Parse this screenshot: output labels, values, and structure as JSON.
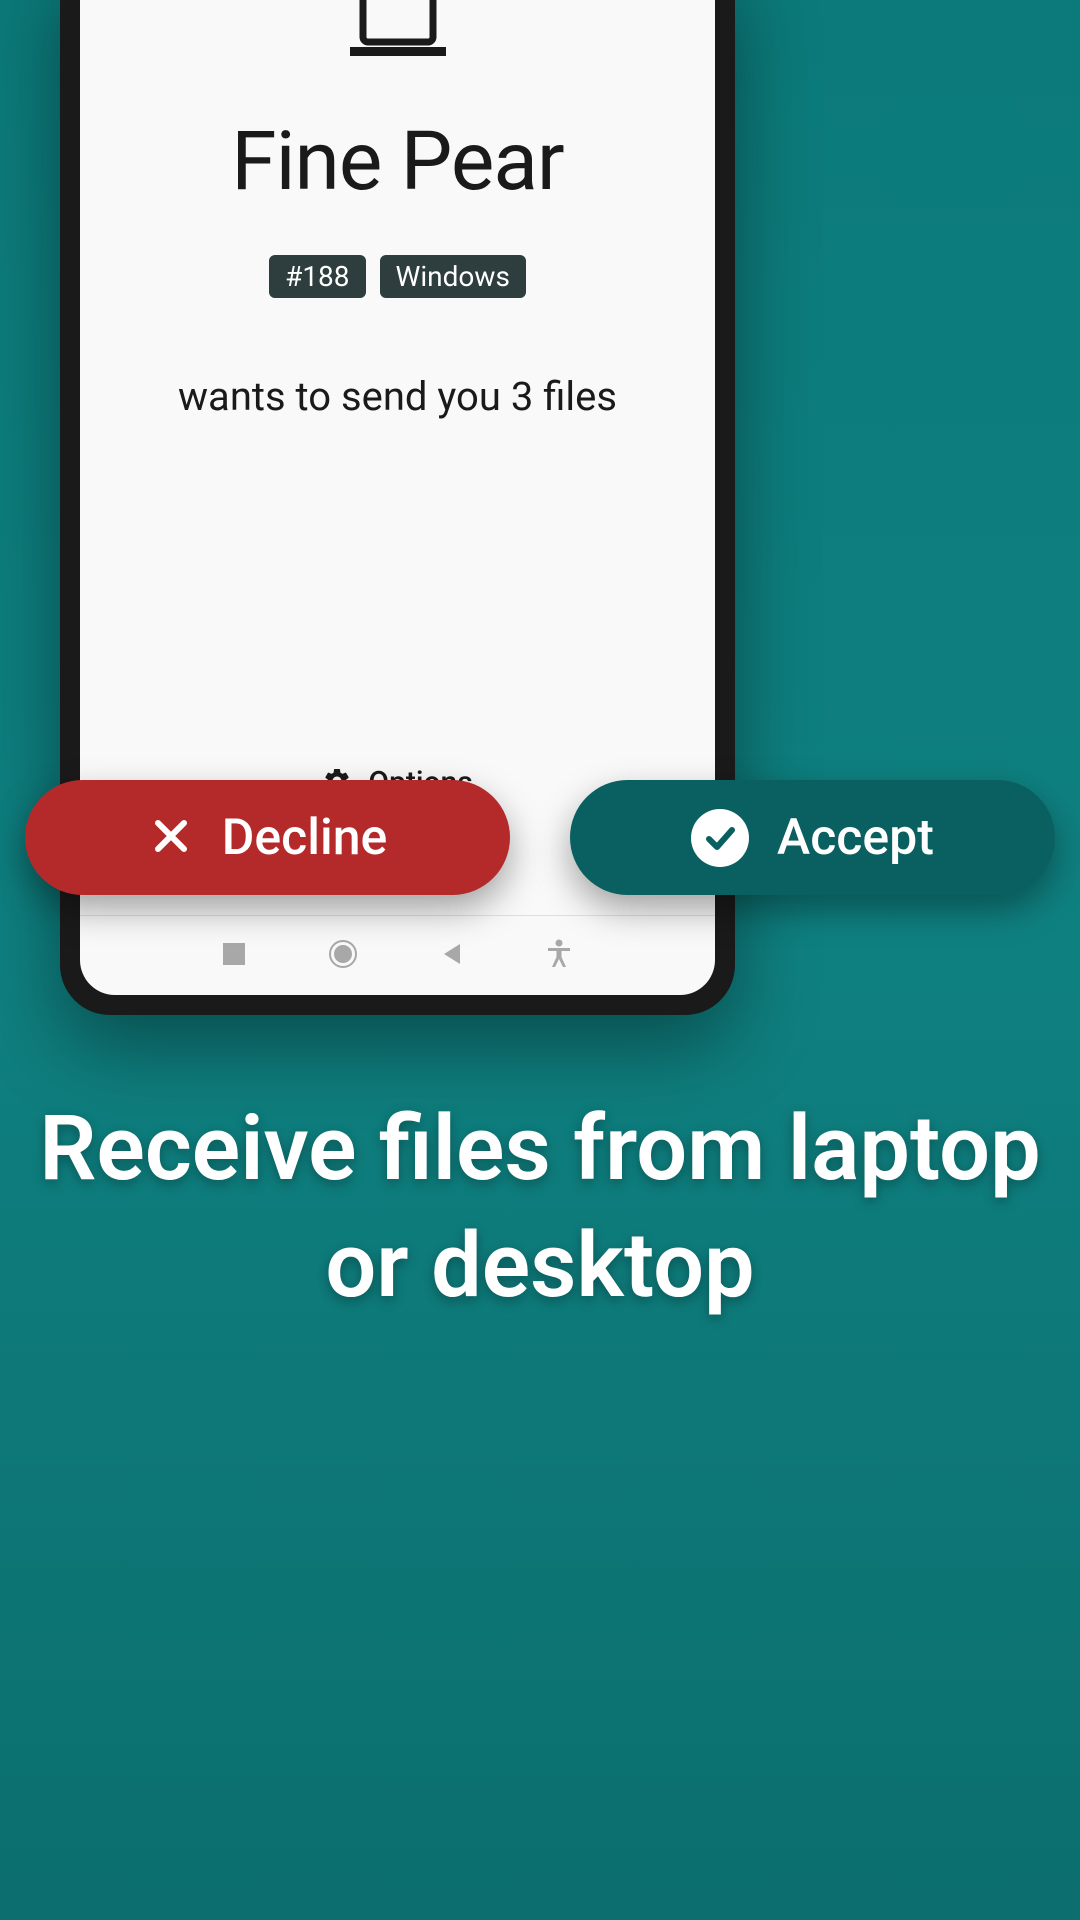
{
  "device": {
    "name": "Fine Pear",
    "id_badge": "#188",
    "os_badge": "Windows"
  },
  "message": "wants to send you 3 files",
  "options_label": "Options",
  "buttons": {
    "decline": "Decline",
    "accept": "Accept"
  },
  "caption": "Receive files from laptop or desktop"
}
